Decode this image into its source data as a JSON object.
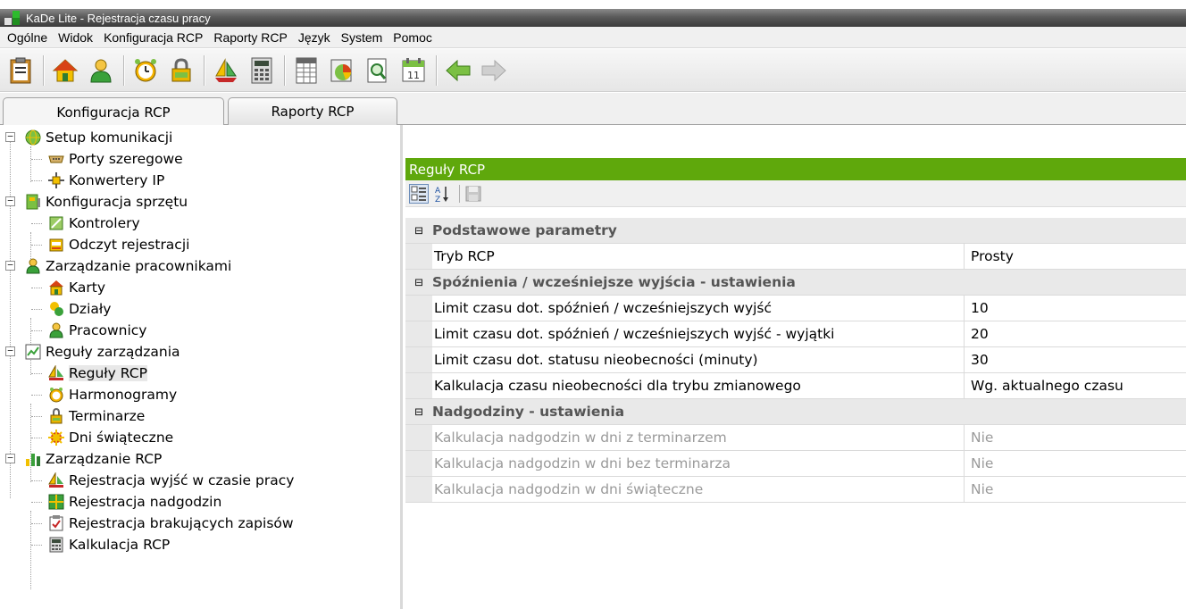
{
  "window": {
    "title": "KaDe Lite - Rejestracja czasu pracy"
  },
  "menu": [
    "Ogólne",
    "Widok",
    "Konfiguracja RCP",
    "Raporty RCP",
    "Język",
    "System",
    "Pomoc"
  ],
  "toolbar": {
    "icons": [
      "clipboard-icon",
      "home-icon",
      "user-icon",
      "alarm-clock-icon",
      "padlock-icon",
      "sailboat-icon",
      "calculator-icon",
      "spreadsheet-icon",
      "chart-icon",
      "search-document-icon",
      "calendar-icon",
      "back-arrow-icon",
      "forward-arrow-icon"
    ],
    "calendar_day": "11"
  },
  "tabs": [
    {
      "label": "Konfiguracja RCP",
      "active": true
    },
    {
      "label": "Raporty RCP",
      "active": false
    }
  ],
  "tree": {
    "items": [
      {
        "label": "Setup komunikacji",
        "level": 0,
        "icon": "globe-icon"
      },
      {
        "label": "Porty szeregowe",
        "level": 1,
        "icon": "serial-port-icon"
      },
      {
        "label": "Konwertery IP",
        "level": 1,
        "icon": "network-converter-icon"
      },
      {
        "label": "Konfiguracja sprzętu",
        "level": 0,
        "icon": "hardware-icon"
      },
      {
        "label": "Kontrolery",
        "level": 1,
        "icon": "controller-icon"
      },
      {
        "label": "Odczyt rejestracji",
        "level": 1,
        "icon": "reader-icon"
      },
      {
        "label": "Zarządzanie pracownikami",
        "level": 0,
        "icon": "users-icon"
      },
      {
        "label": "Karty",
        "level": 1,
        "icon": "card-icon"
      },
      {
        "label": "Działy",
        "level": 1,
        "icon": "departments-icon"
      },
      {
        "label": "Pracownicy",
        "level": 1,
        "icon": "employees-icon"
      },
      {
        "label": "Reguły zarządzania",
        "level": 0,
        "icon": "rules-icon"
      },
      {
        "label": "Reguły RCP",
        "level": 1,
        "icon": "rules-rcp-icon",
        "selected": true
      },
      {
        "label": "Harmonogramy",
        "level": 1,
        "icon": "schedule-icon"
      },
      {
        "label": "Terminarze",
        "level": 1,
        "icon": "timetable-icon"
      },
      {
        "label": "Dni świąteczne",
        "level": 1,
        "icon": "holiday-icon"
      },
      {
        "label": "Zarządzanie RCP",
        "level": 0,
        "icon": "bar-chart-icon"
      },
      {
        "label": "Rejestracja wyjść w czasie pracy",
        "level": 1,
        "icon": "exit-registration-icon"
      },
      {
        "label": "Rejestracja nadgodzin",
        "level": 1,
        "icon": "overtime-icon"
      },
      {
        "label": "Rejestracja brakujących zapisów",
        "level": 1,
        "icon": "missing-records-icon"
      },
      {
        "label": "Kalkulacja RCP",
        "level": 1,
        "icon": "calculator-icon"
      }
    ]
  },
  "panel": {
    "title": "Reguły RCP",
    "toolbar": [
      "categorized-icon",
      "sort-az-icon",
      "save-icon"
    ],
    "categories": [
      {
        "label": "Podstawowe parametry",
        "rows": [
          {
            "name": "Tryb RCP",
            "value": "Prosty",
            "enabled": true
          }
        ]
      },
      {
        "label": "Spóźnienia / wcześniejsze wyjścia - ustawienia",
        "rows": [
          {
            "name": "Limit czasu dot. spóźnień / wcześniejszych wyjść",
            "value": "10",
            "enabled": true
          },
          {
            "name": "Limit czasu dot. spóźnień / wcześniejszych wyjść - wyjątki",
            "value": "20",
            "enabled": true
          },
          {
            "name": "Limit czasu dot. statusu nieobecności (minuty)",
            "value": "30",
            "enabled": true
          },
          {
            "name": "Kalkulacja czasu nieobecności dla trybu zmianowego",
            "value": "Wg. aktualnego czasu",
            "enabled": true
          }
        ]
      },
      {
        "label": "Nadgodziny - ustawienia",
        "rows": [
          {
            "name": "Kalkulacja nadgodzin w dni z terminarzem",
            "value": "Nie",
            "enabled": false
          },
          {
            "name": "Kalkulacja nadgodzin w dni bez terminarza",
            "value": "Nie",
            "enabled": false
          },
          {
            "name": "Kalkulacja nadgodzin w dni świąteczne",
            "value": "Nie",
            "enabled": false
          }
        ]
      }
    ]
  },
  "colors": {
    "accent": "#5fa80c",
    "category_bg": "#e9e9e9",
    "disabled_text": "#9a9a9a"
  }
}
